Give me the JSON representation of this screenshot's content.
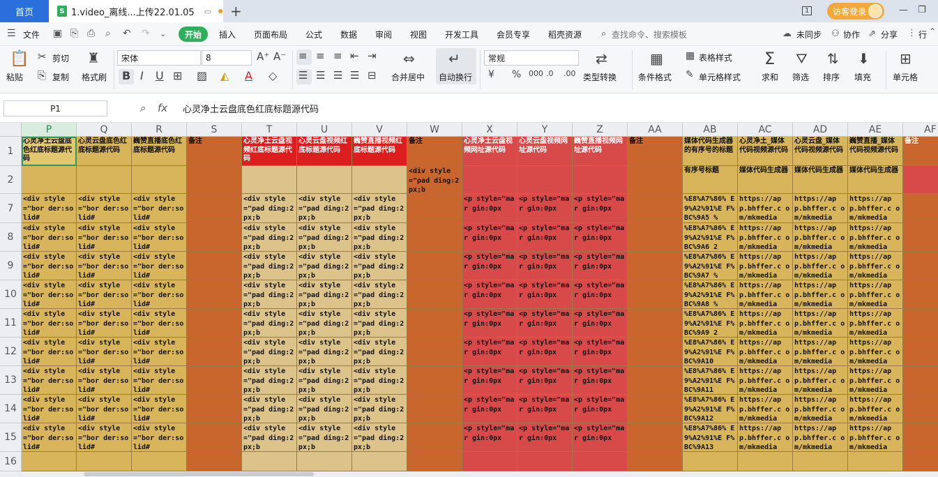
{
  "titlebar": {
    "home_tab": "首页",
    "doc_icon": "S",
    "doc_title": "1.video_离线...上传22.01.05",
    "new_tab": "+",
    "page_count": "1",
    "guest_login": "访客登录",
    "minimize": "—",
    "restore": "❐"
  },
  "menubar": {
    "file": "文件",
    "start": "开始",
    "items": [
      "插入",
      "页面布局",
      "公式",
      "数据",
      "审阅",
      "视图",
      "开发工具",
      "会员专享",
      "稻壳资源"
    ],
    "search": "查找命令、搜索模板",
    "unsynced": "未同步",
    "collab": "协作",
    "share": "分享",
    "more": "行"
  },
  "ribbon": {
    "paste": "粘贴",
    "cut": "剪切",
    "copy": "复制",
    "format_painter": "格式刷",
    "font_name": "宋体",
    "font_size": "8",
    "merge_center": "合并居中",
    "wrap_text": "自动换行",
    "number_format": "常规",
    "type_convert": "类型转换",
    "cond_format": "条件格式",
    "table_style": "表格样式",
    "cell_style": "单元格样式",
    "sum": "求和",
    "filter": "筛选",
    "sort": "排序",
    "fill": "填充",
    "cell": "单元格"
  },
  "formula": {
    "cell_ref": "P1",
    "fx": "fx",
    "content": "心灵净土云盘底色红底标题源代码"
  },
  "grid": {
    "columns": [
      "P",
      "Q",
      "R",
      "S",
      "T",
      "U",
      "V",
      "W",
      "X",
      "Y",
      "Z",
      "AA",
      "AB",
      "AC",
      "AD",
      "AE",
      "AF"
    ],
    "row_numbers": [
      "1",
      "2",
      "7",
      "8",
      "9",
      "10",
      "11",
      "12",
      "13",
      "14",
      "15",
      "16"
    ],
    "colors": {
      "gold": "#d8b55a",
      "orange": "#c9662e",
      "tan": "#dcc38a",
      "red": "#d84a4a",
      "bright_red": "#dd1e1e",
      "salmon": "#d9534f",
      "pale_gold": "#e2c770"
    },
    "header_row": [
      "心灵净土云盘底色红底标题源代码",
      "心灵云盘底色红底标题源代码",
      "巍赞直播底色红底标题源代码",
      "备注",
      "心灵净土云盘视频红底标题源代码",
      "心灵云盘视频红底标题源代码",
      "巍赞直播视频红底标题源代码",
      "备注",
      "心灵净土云盘视频网址源代码",
      "心灵云盘视频网址源代码",
      "巍赞直播视频网址源代码",
      "备注",
      "媒体代码生成器的有序号的标题",
      "心灵净土_媒体代码视频源代码",
      "心灵云盘_媒体代码视频源代码",
      "巍赞直播_媒体代码视频源代码",
      "备注"
    ],
    "row2": [
      "",
      "",
      "",
      "",
      "",
      "",
      "",
      "<div style=\"pad ding:2px;b",
      "",
      "",
      "",
      "",
      "有序号标题",
      "媒体代码生成器",
      "媒体代码生成器",
      "媒体代码生成器",
      ""
    ],
    "div_border": "<div style=\"bor der:solid#",
    "div_pad": "<div style=\"pad ding:2px;b",
    "p_margin": "<p style=\"mar gin:0px",
    "app_url": "https://ap p.bhffer.c om/mkmedia",
    "ab_values": [
      "%E8%A7%86% E9%A2%91%E F%BC%9A5 %",
      "%E8%A7%86% E9%A2%91%E F%BC%9A6 2",
      "%E8%A7%86% E9%A2%91%E F%BC%9A7 %",
      "%E8%A7%86% E9%A2%91%E F%BC%9A8 %",
      "%E8%A7%86% E9%A2%91%E F%BC%9A9 2",
      "%E8%A7%86% E9%A2%91%E F%BC%9A10",
      "%E8%A7%86% E9%A2%91%E F%BC%9A11",
      "%E8%A7%86% E9%A2%91%E F%BC%9A12",
      "%E8%A7%86% E9%A2%91%E F%BC%9A13"
    ]
  }
}
